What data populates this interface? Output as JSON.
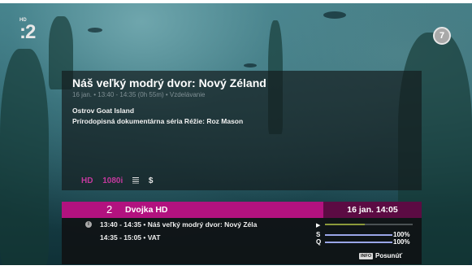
{
  "channel_logo": ":2",
  "channel_logo_badge": "HD",
  "notification_count": "7",
  "program": {
    "title": "Náš veľký modrý dvor: Nový Zéland",
    "subline": "16 jan. • 13:40 - 14:35 (0h 55m) • Vzdelávanie",
    "description_line1": "Ostrov Goat Island",
    "description_line2": "Prírodopisná dokumentárna séria Réžie: Roz Mason",
    "badges": {
      "hd": "HD",
      "resolution": "1080i",
      "subtitles_icon": "subtitles-icon",
      "price": "$"
    }
  },
  "channel_bar": {
    "number": "2",
    "name": "Dvojka HD",
    "datetime": "16 jan. 14:05"
  },
  "epg": {
    "current_event": "13:40 - 14:35 • Náš veľký modrý dvor: Nový Zéla",
    "next_event": "14:35 - 15:05 • VAT",
    "progress_fraction": 0.45,
    "signal": {
      "s_label": "S",
      "s_value": "100%",
      "s_fraction": 1.0,
      "q_label": "Q",
      "q_value": "100%",
      "q_fraction": 1.0
    },
    "info_key_label": "INFO",
    "move_label": "Posunúť"
  },
  "colors": {
    "accent_magenta": "#b2127f",
    "time_box": "#5c0b43",
    "progress_green": "#8c9a3a",
    "signal_blue": "#9aa6e8"
  }
}
